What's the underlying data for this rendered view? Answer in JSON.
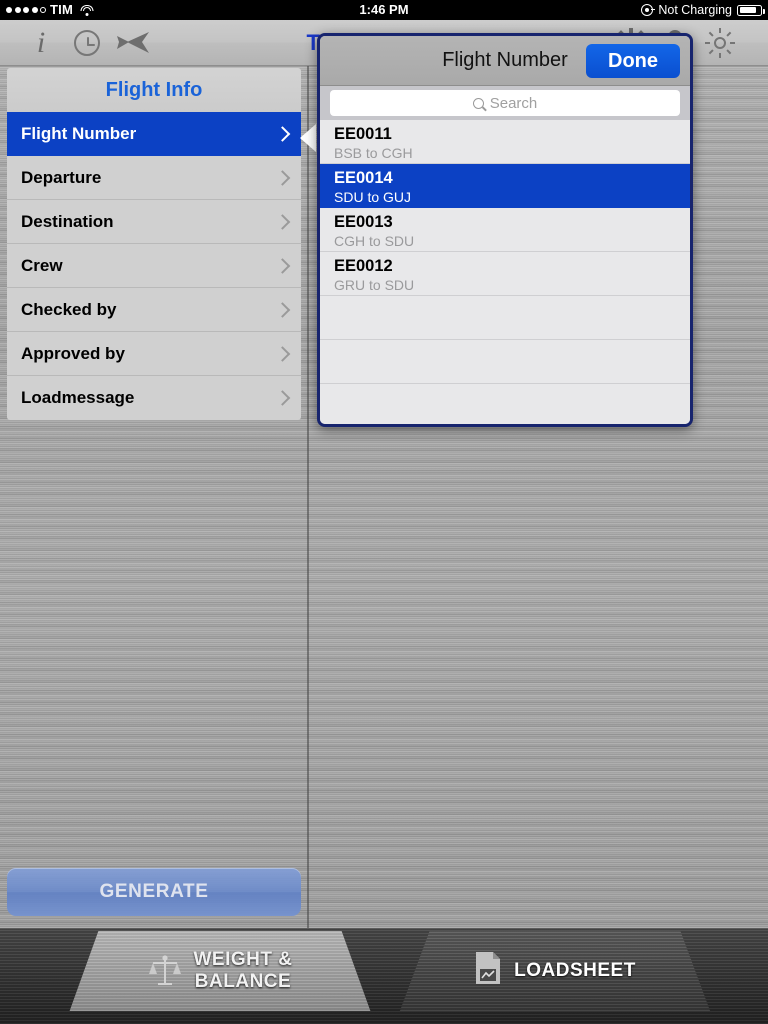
{
  "status_bar": {
    "carrier": "TIM",
    "signal_dots_total": 5,
    "signal_dots_filled": 4,
    "wifi_icon": "wifi-icon",
    "time": "1:46 PM",
    "charging_label": "Not Charging",
    "plug_icon": "plug-icon",
    "battery_icon": "battery-icon"
  },
  "toolbar": {
    "title": "TAIL NUMBER",
    "info_icon": "info-icon",
    "clock_icon": "clock-icon",
    "back_icon": "back-arrow-icon",
    "settings_icon": "gear-icon",
    "user_icon": "user-icon",
    "brightness_icon": "sun-icon"
  },
  "sidebar": {
    "header": "Flight Info",
    "items": [
      {
        "label": "Flight Number",
        "selected": true
      },
      {
        "label": "Departure",
        "selected": false
      },
      {
        "label": "Destination",
        "selected": false
      },
      {
        "label": "Crew",
        "selected": false
      },
      {
        "label": "Checked by",
        "selected": false
      },
      {
        "label": "Approved by",
        "selected": false
      },
      {
        "label": "Loadmessage",
        "selected": false
      }
    ],
    "generate_button": "GENERATE"
  },
  "popover": {
    "title": "Flight Number",
    "done_label": "Done",
    "search_placeholder": "Search",
    "search_value": "",
    "search_icon": "magnifier-icon",
    "flights": [
      {
        "code": "EE0011",
        "route": "BSB to CGH",
        "selected": false
      },
      {
        "code": "EE0014",
        "route": "SDU to GUJ",
        "selected": true
      },
      {
        "code": "EE0013",
        "route": "CGH to SDU",
        "selected": false
      },
      {
        "code": "EE0012",
        "route": "GRU to SDU",
        "selected": false
      }
    ],
    "empty_rows": 3
  },
  "tabbar": {
    "tabs": [
      {
        "label_line1": "WEIGHT &",
        "label_line2": "BALANCE",
        "icon": "scales-icon",
        "active": true
      },
      {
        "label_line1": "LOADSHEET",
        "label_line2": "",
        "icon": "document-chart-icon",
        "active": false
      }
    ]
  },
  "colors": {
    "accent_blue": "#0c41c4",
    "title_blue": "#1a38c8",
    "popover_border": "#17246e"
  }
}
